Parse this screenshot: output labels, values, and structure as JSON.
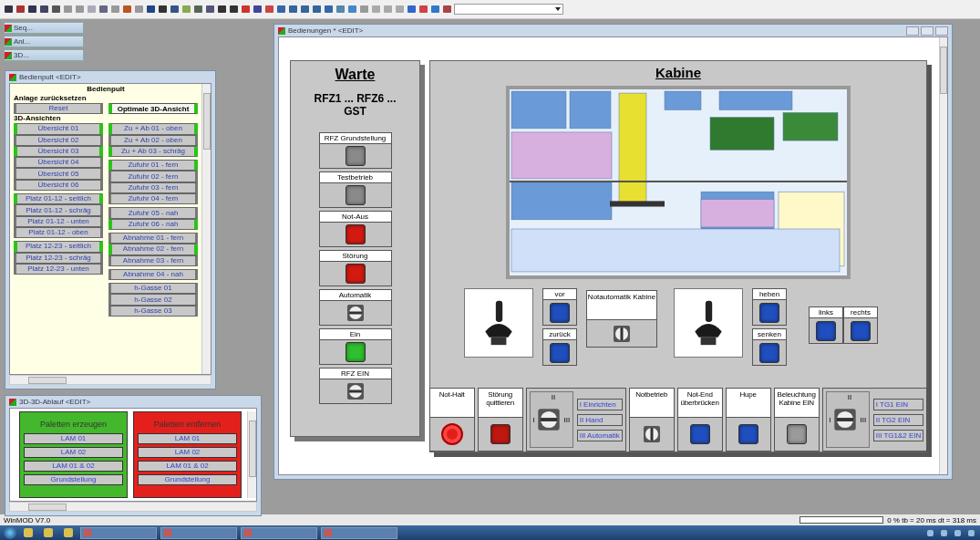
{
  "minimized_windows": [
    "Seq...",
    "Anl...",
    "3D..."
  ],
  "bedienpult": {
    "title": "Bedienpult <EDIT>",
    "heading": "Bedienpult",
    "reset_label": "Anlage zurücksetzen",
    "reset_button": "Reset",
    "optimal_button": {
      "label": "Optimale 3D-Ansicht",
      "active": true
    },
    "views_label": "3D-Ansichten",
    "left_groups": [
      [
        {
          "label": "Übersicht 01",
          "active": true
        },
        {
          "label": "Übersicht 02",
          "active": false
        },
        {
          "label": "Übersicht 03",
          "active": true
        },
        {
          "label": "Übersicht 04",
          "active": false
        },
        {
          "label": "Übersicht 05",
          "active": false
        },
        {
          "label": "Übersicht 06",
          "active": false
        }
      ],
      [
        {
          "label": "Platz 01-12 - seitlich",
          "active": true
        },
        {
          "label": "Platz 01-12 - schräg",
          "active": false
        },
        {
          "label": "Platz 01-12 - unten",
          "active": false
        },
        {
          "label": "Platz 01-12 - oben",
          "active": false
        }
      ],
      [
        {
          "label": "Platz 12-23 - seitlich",
          "active": true
        },
        {
          "label": "Platz 12-23 - schräg",
          "active": false
        },
        {
          "label": "Platz 12-23 - unten",
          "active": false
        }
      ]
    ],
    "right_groups": [
      [
        {
          "label": "Zu + Ab 01 - oben",
          "active": true
        },
        {
          "label": "Zu + Ab 02 - oben",
          "active": false
        },
        {
          "label": "Zu + Ab 03 - schräg",
          "active": true
        }
      ],
      [
        {
          "label": "Zufuhr 01 - fern",
          "active": true
        },
        {
          "label": "Zufuhr 02 - fern",
          "active": false
        },
        {
          "label": "Zufuhr 03 - fern",
          "active": false
        },
        {
          "label": "Zufuhr 04 - fern",
          "active": false
        }
      ],
      [
        {
          "label": "Zufuhr 05 - nah",
          "active": false
        },
        {
          "label": "Zufuhr 06 - nah",
          "active": true
        }
      ],
      [
        {
          "label": "Abnahme 01 - fern",
          "active": false
        },
        {
          "label": "Abnahme 02 - fern",
          "active": true
        },
        {
          "label": "Abnahme 03 - fern",
          "active": false
        }
      ],
      [
        {
          "label": "Abnahme 04 - nah",
          "active": false
        }
      ],
      [
        {
          "label": "h-Gasse 01",
          "active": false
        },
        {
          "label": "h-Gasse 02",
          "active": false
        },
        {
          "label": "h-Gasse 03",
          "active": false
        }
      ]
    ]
  },
  "vorlage": {
    "title": "3D-3D-Ablauf <EDIT>",
    "panels": [
      {
        "heading": "Paletten erzeugen",
        "color": "#44b82c",
        "buttons": [
          "LAM 01",
          "LAM 02",
          "LAM 01 & 02",
          "Grundstellung"
        ]
      },
      {
        "heading": "Paletten entfernen",
        "color": "#e4201c",
        "buttons": [
          "LAM 01",
          "LAM 02",
          "LAM 01 & 02",
          "Grundstellung"
        ]
      }
    ]
  },
  "main_window": {
    "title": "Bedienungen * <EDIT>"
  },
  "warte": {
    "heading": "Warte",
    "subtitle": "RFZ1 ... RFZ6 ... GST",
    "items": [
      {
        "label": "RFZ Grundstellung",
        "kind": "lamp",
        "color": "#8a8a8a"
      },
      {
        "label": "Testbetrieb",
        "kind": "lamp",
        "color": "#8a8a8a"
      },
      {
        "label": "Not-Aus",
        "kind": "lamp",
        "color": "#d41a10"
      },
      {
        "label": "Störung",
        "kind": "lamp",
        "color": "#d41a10"
      },
      {
        "label": "Automatik",
        "kind": "switch"
      },
      {
        "label": "Ein",
        "kind": "lamp",
        "color": "#2fbf2f"
      },
      {
        "label": "RFZ EIN",
        "kind": "switch"
      }
    ]
  },
  "kabine": {
    "heading": "Kabine",
    "drive_buttons": [
      "vor",
      "zurück"
    ],
    "emergency_auto": "Notautomatik Kabine",
    "lift_buttons": [
      "heben",
      "senken"
    ],
    "side_buttons": [
      "links",
      "rechts"
    ],
    "bottom_left": [
      {
        "label": "Not-Halt",
        "kind": "mushroom",
        "color": "#e02018"
      },
      {
        "label": "Störung quittieren",
        "kind": "lamp",
        "color": "#c01810"
      }
    ],
    "mode_switch": {
      "positions": [
        "I",
        "II",
        "III"
      ],
      "options": [
        "I  Einrichten",
        "II  Hand",
        "III  Automatik"
      ]
    },
    "bottom_middle": [
      {
        "label": "Notbetrieb",
        "kind": "switch"
      },
      {
        "label": "Not-End überbrücken",
        "kind": "lamp",
        "color": "#1f4fbf"
      },
      {
        "label": "Hupe",
        "kind": "lamp",
        "color": "#1f4fbf"
      },
      {
        "label": "Beleuchtung Kabine EIN",
        "kind": "lamp",
        "color": "#9a9a9a"
      }
    ],
    "tg_switch": {
      "positions": [
        "I",
        "II",
        "III"
      ],
      "options": [
        "I  TG1 EIN",
        "II  TG2 EIN",
        "III  TG1&2 EIN"
      ]
    }
  },
  "status_bar": {
    "app": "WinMOD V7.0",
    "progress": {
      "level": 0
    },
    "stats": "0 % tb = 20 ms  dt = 318 ms"
  }
}
